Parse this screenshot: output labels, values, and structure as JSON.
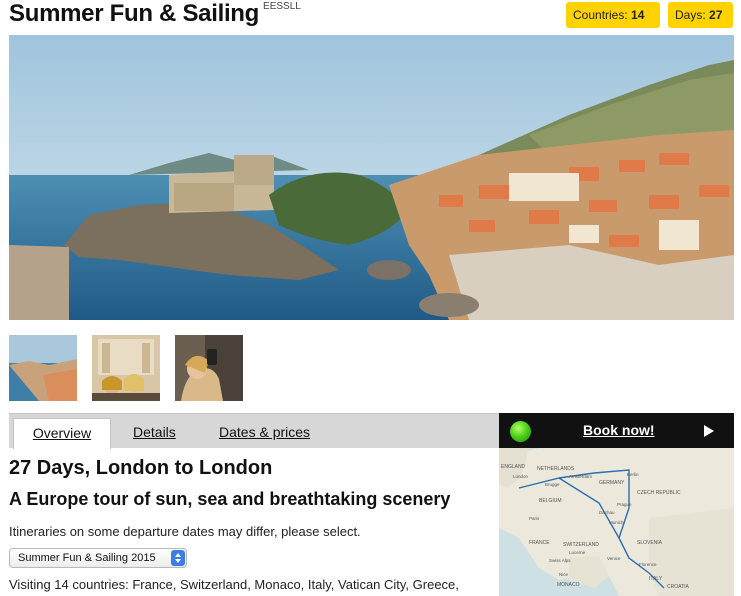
{
  "tour": {
    "title": "Summer Fun & Sailing",
    "code": "EESSLL"
  },
  "badges": {
    "countries_label": "Countries:",
    "countries_value": "14",
    "days_label": "Days:",
    "days_value": "27"
  },
  "tabs": [
    {
      "label": "Overview",
      "active": true
    },
    {
      "label": "Details",
      "active": false
    },
    {
      "label": "Dates & prices",
      "active": false
    }
  ],
  "booking": {
    "label": "Book now!",
    "status_color": "#4fd21a"
  },
  "overview": {
    "heading": "27 Days, London to London",
    "subheading": "A Europe tour of sun, sea and breathtaking scenery",
    "note": "Itineraries on some departure dates may differ, please select.",
    "departure_select_value": "Summer Fun & Sailing 2015",
    "visiting": "Visiting 14 countries: France, Switzerland, Monaco, Italy, Vatican City, Greece,"
  },
  "map": {
    "labels": [
      "ENGLAND",
      "NETHERLANDS",
      "London",
      "Amsterdam",
      "Brugge",
      "GERMANY",
      "Berlin",
      "BELGIUM",
      "CZECH REPUBLIC",
      "Prague",
      "Paris",
      "Dachau",
      "Munich",
      "FRANCE",
      "SWITZERLAND",
      "Lucerne",
      "Venice",
      "SLOVENIA",
      "Swiss Alps",
      "Nice",
      "Florence",
      "MONACO",
      "ITALY",
      "CROATIA"
    ]
  },
  "colors": {
    "badge": "#ffd200",
    "tabbar": "#d7d7d7",
    "book_bar": "#111111"
  }
}
